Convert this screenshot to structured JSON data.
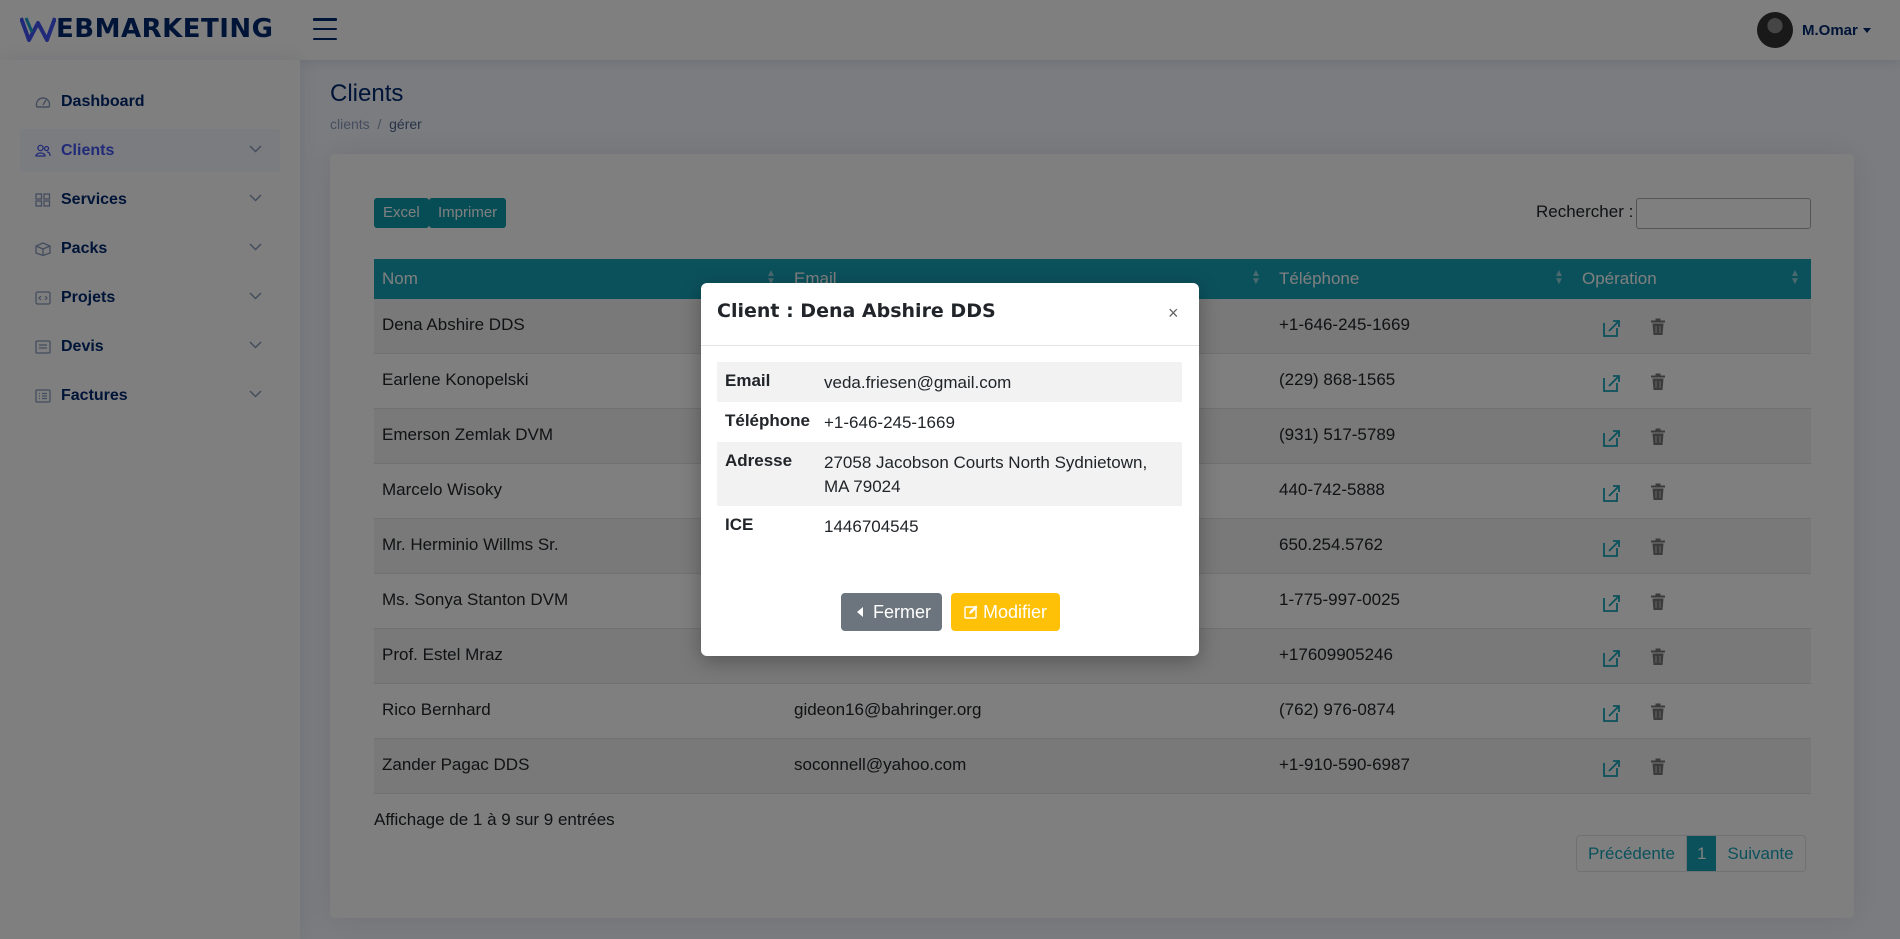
{
  "header": {
    "logo_text": "EBMARKETING",
    "user_name": "M.Omar"
  },
  "sidebar": {
    "items": [
      {
        "label": "Dashboard",
        "icon": "speedometer-icon"
      },
      {
        "label": "Clients",
        "icon": "people-icon"
      },
      {
        "label": "Services",
        "icon": "grid-icon"
      },
      {
        "label": "Packs",
        "icon": "box-icon"
      },
      {
        "label": "Projets",
        "icon": "code-window-icon"
      },
      {
        "label": "Devis",
        "icon": "document-list-icon"
      },
      {
        "label": "Factures",
        "icon": "receipt-icon"
      }
    ]
  },
  "page": {
    "title": "Clients",
    "breadcrumb": [
      "clients",
      "gérer"
    ]
  },
  "toolbar": {
    "excel_label": "Excel",
    "print_label": "Imprimer",
    "search_label": "Rechercher :",
    "search_value": ""
  },
  "table": {
    "columns": [
      "Nom",
      "Email",
      "Téléphone",
      "Opération"
    ],
    "rows": [
      {
        "name": "Dena Abshire DDS",
        "email": "",
        "phone": "+1-646-245-1669"
      },
      {
        "name": "Earlene Konopelski",
        "email": "",
        "phone": "(229) 868-1565"
      },
      {
        "name": "Emerson Zemlak DVM",
        "email": "",
        "phone": "(931) 517-5789"
      },
      {
        "name": "Marcelo Wisoky",
        "email": "",
        "phone": "440-742-5888"
      },
      {
        "name": "Mr. Herminio Willms Sr.",
        "email": "",
        "phone": "650.254.5762"
      },
      {
        "name": "Ms. Sonya Stanton DVM",
        "email": "",
        "phone": "1-775-997-0025"
      },
      {
        "name": "Prof. Estel Mraz",
        "email": "",
        "phone": "+17609905246"
      },
      {
        "name": "Rico Bernhard",
        "email": "gideon16@bahringer.org",
        "phone": "(762) 976-0874"
      },
      {
        "name": "Zander Pagac DDS",
        "email": "soconnell@yahoo.com",
        "phone": "+1-910-590-6987"
      }
    ],
    "info": "Affichage de 1 à 9 sur 9 entrées",
    "pager": {
      "prev": "Précédente",
      "current": "1",
      "next": "Suivante"
    }
  },
  "modal": {
    "title": "Client : Dena Abshire DDS",
    "close_symbol": "×",
    "fields": [
      {
        "label": "Email",
        "value": "veda.friesen@gmail.com"
      },
      {
        "label": "Téléphone",
        "value": "+1-646-245-1669"
      },
      {
        "label": "Adresse",
        "value": "27058 Jacobson Courts North Sydnietown, MA 79024"
      },
      {
        "label": "ICE",
        "value": "1446704545"
      }
    ],
    "close_label": "Fermer",
    "edit_label": "Modifier"
  },
  "colors": {
    "accent": "#17a3b8",
    "brand": "#012970",
    "warning": "#ffc107",
    "secondary": "#6c757d"
  }
}
